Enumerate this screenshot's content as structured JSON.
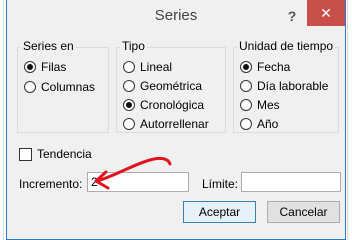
{
  "dialog": {
    "title": "Series",
    "help_label": "?",
    "close_label": "✕"
  },
  "series_en": {
    "title": "Series en",
    "options": [
      {
        "label": "Filas",
        "checked": true
      },
      {
        "label": "Columnas",
        "checked": false
      }
    ]
  },
  "tipo": {
    "title": "Tipo",
    "options": [
      {
        "label": "Lineal",
        "checked": false
      },
      {
        "label": "Geométrica",
        "checked": false
      },
      {
        "label": "Cronológica",
        "checked": true
      },
      {
        "label": "Autorrellenar",
        "checked": false
      }
    ]
  },
  "unidad": {
    "title": "Unidad de tiempo",
    "options": [
      {
        "label": "Fecha",
        "checked": true
      },
      {
        "label": "Día laborable",
        "checked": false
      },
      {
        "label": "Mes",
        "checked": false
      },
      {
        "label": "Año",
        "checked": false
      }
    ]
  },
  "tendencia": {
    "label": "Tendencia",
    "checked": false
  },
  "incremento": {
    "label": "Incremento:",
    "value": "2"
  },
  "limite": {
    "label": "Límite:",
    "value": ""
  },
  "buttons": {
    "accept": "Aceptar",
    "cancel": "Cancelar"
  },
  "annotation": {
    "color": "#e0141e",
    "icon": "red-hand-drawn-arrow-icon"
  }
}
